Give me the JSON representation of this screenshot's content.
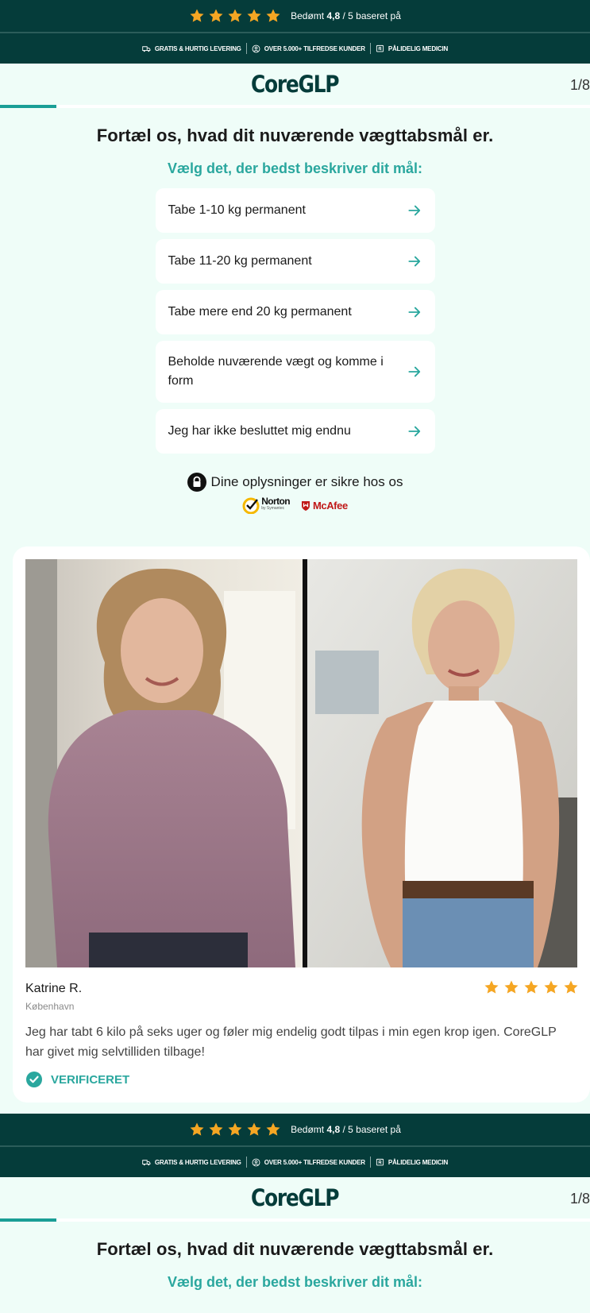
{
  "rating_bar": {
    "stars": 5,
    "rated_prefix": "Bedømt ",
    "rating": "4,8",
    "rated_suffix": " / 5 baseret på"
  },
  "features": [
    {
      "icon": "truck-icon",
      "label": "GRATIS & HURTIG LEVERING"
    },
    {
      "icon": "user-circle-icon",
      "label": "OVER 5.000+ TILFREDSE KUNDER"
    },
    {
      "icon": "prescription-icon",
      "label": "PÅLIDELIG MEDICIN"
    }
  ],
  "header": {
    "logo": "CoreGLP",
    "step": "1/8",
    "progress_fraction": 0.125
  },
  "quiz": {
    "question": "Fortæl os, hvad dit nuværende vægttabsmål er.",
    "subtitle": "Vælg det, der bedst beskriver dit mål:",
    "options": [
      {
        "label": "Tabe 1-10 kg permanent"
      },
      {
        "label": "Tabe 11-20 kg permanent"
      },
      {
        "label": "Tabe mere end 20 kg permanent"
      },
      {
        "label": "Beholde nuværende vægt og komme i form"
      },
      {
        "label": "Jeg har ikke besluttet mig endnu"
      }
    ]
  },
  "security": {
    "text": "Dine oplysninger er sikre hos os",
    "norton": "Norton",
    "norton_sub": "by Symantec",
    "mcafee": "McAfee"
  },
  "testimonial": {
    "name": "Katrine R.",
    "city": "København",
    "stars": 5,
    "text": "Jeg har tabt 6 kilo på seks uger og føler mig endelig godt tilpas i min egen krop igen. CoreGLP har givet mig selvtilliden tilbage!",
    "verified": "VERIFICERET"
  },
  "colors": {
    "dark_teal": "#053c3a",
    "accent": "#2aa79e",
    "star": "#f5a623",
    "page_bg": "#effdf8"
  }
}
